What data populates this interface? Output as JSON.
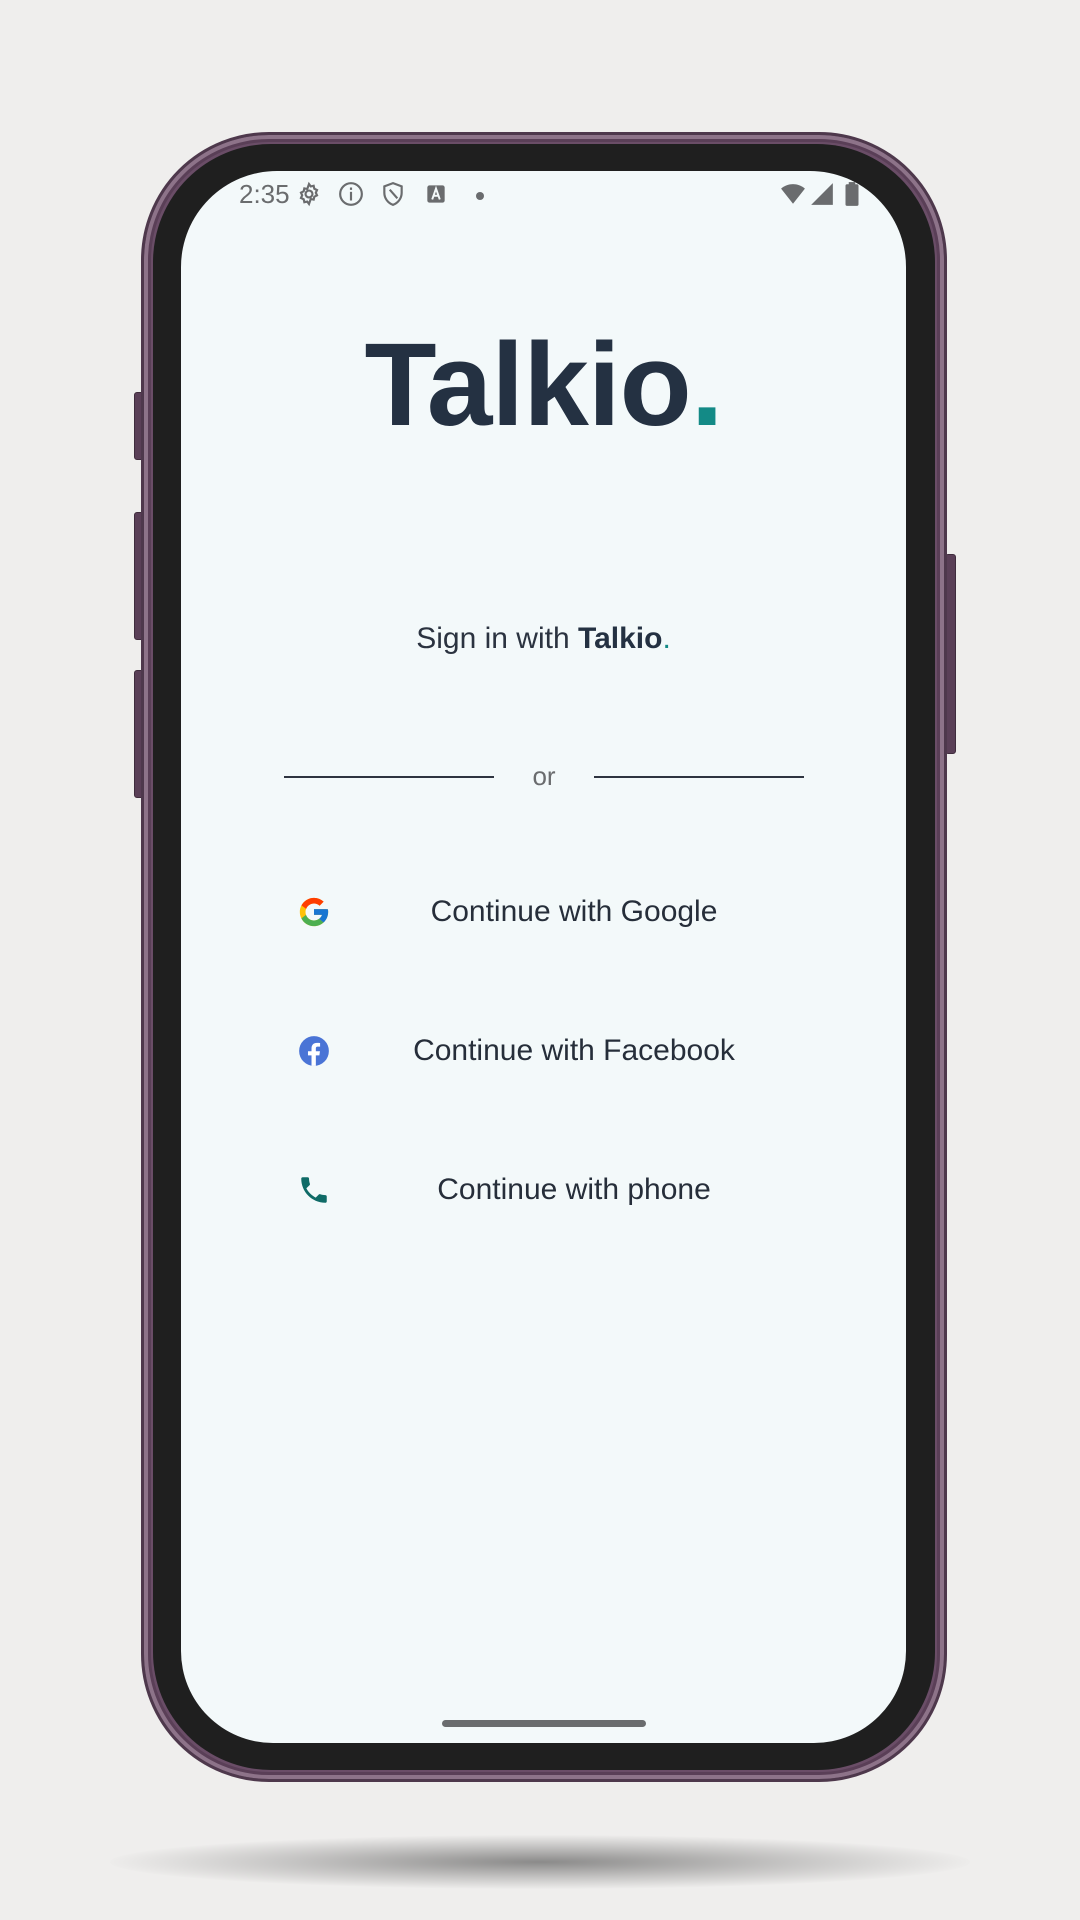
{
  "status_bar": {
    "time": "2:35",
    "icons": [
      "settings-icon",
      "info-icon",
      "shield-icon",
      "text-a-icon",
      "dot-icon",
      "wifi-icon",
      "signal-icon",
      "battery-icon"
    ]
  },
  "logo": {
    "name": "Talkio",
    "dot": ".",
    "accent_color": "#138a86",
    "text_color": "#243142"
  },
  "signin": {
    "prefix": "Sign in with ",
    "brand": "Talkio",
    "dot": "."
  },
  "divider": {
    "label": "or"
  },
  "auth_buttons": [
    {
      "icon": "google-icon",
      "label": "Continue with Google"
    },
    {
      "icon": "facebook-icon",
      "label": "Continue with Facebook"
    },
    {
      "icon": "phone-icon",
      "label": "Continue with phone"
    }
  ],
  "colors": {
    "screen_background": "#f3f9fa",
    "frame": "#6a4d67",
    "facebook_blue": "#4a74d6",
    "phone_teal": "#0f6b67"
  }
}
